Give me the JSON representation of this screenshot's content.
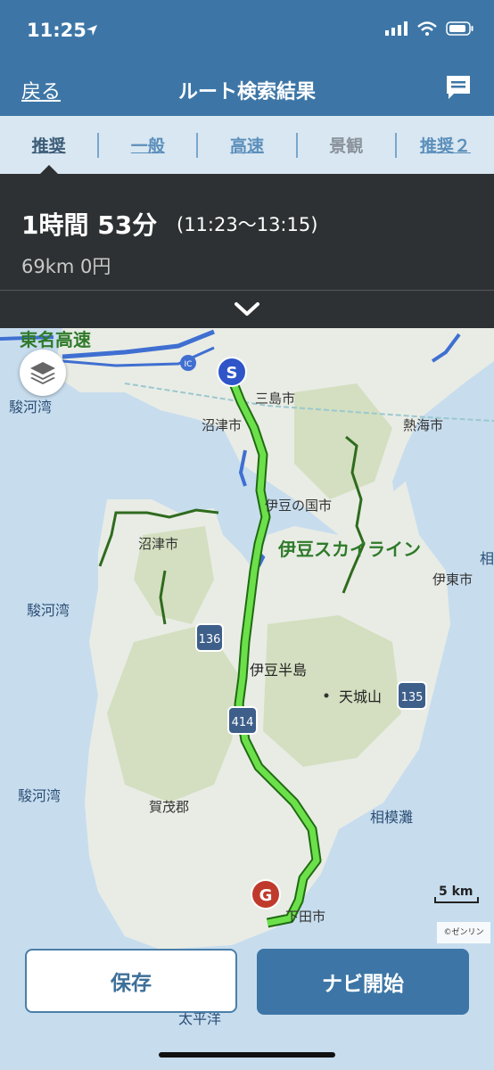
{
  "status_bar": {
    "time": "11:25"
  },
  "nav": {
    "back_label": "戻る",
    "title": "ルート検索結果"
  },
  "tabs": [
    {
      "label": "推奨",
      "state": "active"
    },
    {
      "label": "一般",
      "state": "link"
    },
    {
      "label": "高速",
      "state": "link"
    },
    {
      "label": "景観",
      "state": "disabled"
    },
    {
      "label": "推奨２",
      "state": "link"
    }
  ],
  "summary": {
    "duration": "1時間 53分",
    "time_range": "(11:23〜13:15)",
    "distance_cost": "69km  0円"
  },
  "map": {
    "labels": {
      "expressway": "東名高速",
      "ic": "IC",
      "bay_north": "駿河湾",
      "mishima": "三島市",
      "numazu_city": "沼津市",
      "atami": "熱海市",
      "izunokuni": "伊豆の国市",
      "skyline": "伊豆スカイライン",
      "numazu_west": "沼津市",
      "ito": "伊東市",
      "ai_partial": "相",
      "bay_mid": "駿河湾",
      "route136": "136",
      "izu_peninsula": "伊豆半島",
      "amagi": "天城山",
      "route135": "135",
      "route414": "414",
      "bay_south": "駿河湾",
      "kamo": "賀茂郡",
      "sagami": "相模灘",
      "shimoda": "下田市",
      "pacific": "太平洋",
      "start_marker": "S",
      "goal_marker": "G",
      "scale": "5 km",
      "copyright": "©ゼンリン"
    },
    "colors": {
      "route": "#6ce04a",
      "route_border": "#1f6b12",
      "sea": "#c7ddee",
      "land": "#e9ece5",
      "forest": "#d3dfc0"
    }
  },
  "buttons": {
    "save": "保存",
    "navi_start": "ナビ開始"
  }
}
